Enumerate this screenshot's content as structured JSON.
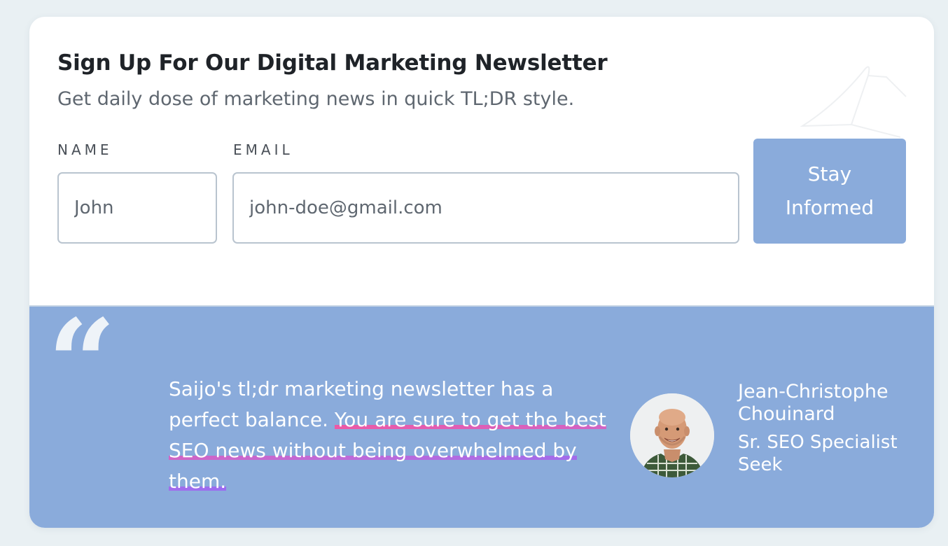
{
  "newsletter": {
    "title": "Sign Up For Our Digital Marketing Newsletter",
    "subtitle": "Get daily dose of marketing news in quick TL;DR style.",
    "name_label": "NAME",
    "name_value": "John",
    "email_label": "EMAIL",
    "email_value": "john-doe@gmail.com",
    "submit_label": "Stay Informed"
  },
  "testimonial": {
    "quote_plain": "Saijo's tl;dr marketing newsletter has a perfect balance. ",
    "quote_highlight": "You are sure to get the best SEO news without being overwhelmed by them.",
    "author_name": "Jean-Christophe Chouinard",
    "author_role": "Sr. SEO Specialist",
    "author_company": "Seek",
    "avatar_icon": "person-avatar-icon"
  },
  "colors": {
    "accent": "#8aabdb",
    "highlight_start": "#ec5aa6",
    "highlight_end": "#9b6cf0",
    "background": "#e9f0f3"
  }
}
